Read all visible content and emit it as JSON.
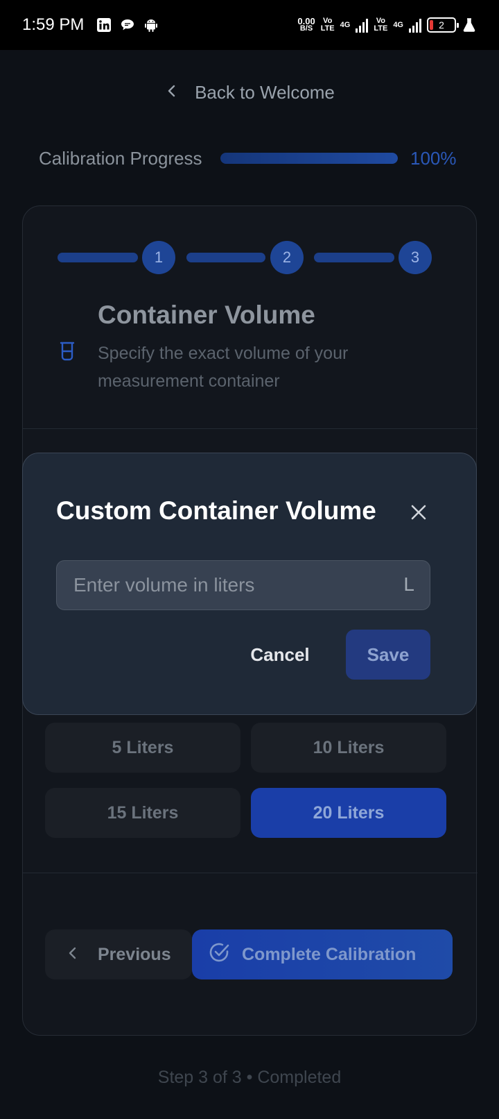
{
  "status_bar": {
    "time": "1:59 PM",
    "net_speed_value": "0.00",
    "net_speed_unit": "B/S",
    "volte_1_top": "Vo",
    "volte_1_bottom": "LTE",
    "network_1": "4G",
    "volte_2_top": "Vo",
    "volte_2_bottom": "LTE",
    "network_2": "4G",
    "battery_level": "2",
    "icons": [
      "linkedin-icon",
      "chat-icon",
      "android-icon",
      "flask-icon"
    ]
  },
  "header": {
    "back_label": "Back to Welcome"
  },
  "progress": {
    "label": "Calibration Progress",
    "percent_text": "100%",
    "value": 1.0
  },
  "stepper": {
    "steps": [
      "1",
      "2",
      "3"
    ],
    "current": 3
  },
  "section": {
    "title": "Container Volume",
    "description": "Specify the exact volume of your measurement container",
    "icon": "beaker-icon"
  },
  "options": [
    {
      "label": "5 Liters",
      "selected": false
    },
    {
      "label": "10 Liters",
      "selected": false
    },
    {
      "label": "15 Liters",
      "selected": false
    },
    {
      "label": "20 Liters",
      "selected": true
    }
  ],
  "navigation": {
    "previous_label": "Previous",
    "complete_label": "Complete Calibration"
  },
  "footer": {
    "note": "Step 3 of 3 • Completed"
  },
  "dialog": {
    "title": "Custom Container Volume",
    "input_placeholder": "Enter volume in liters",
    "input_value": "",
    "unit": "L",
    "cancel_label": "Cancel",
    "save_label": "Save"
  },
  "colors": {
    "accent": "#1a3ea8",
    "background": "#0d1117",
    "dialog_bg": "#1f2937"
  }
}
